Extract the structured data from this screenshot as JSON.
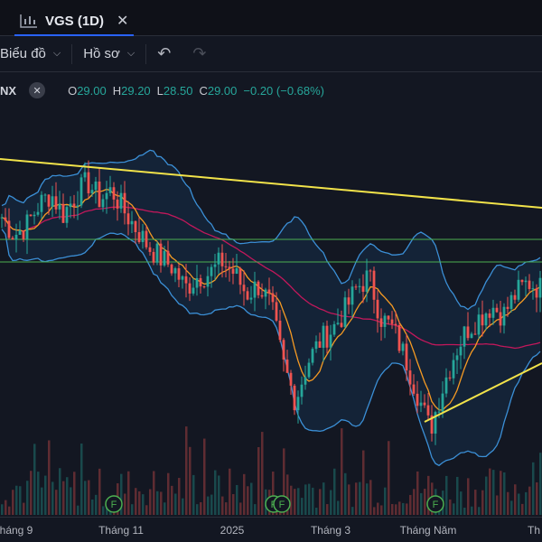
{
  "tab": {
    "title": "VGS (1D)",
    "icon": "chart-icon",
    "close": "✕"
  },
  "toolbar": {
    "chart_label": "Biểu đồ",
    "profile_label": "Hồ sơ",
    "undo_icon": "undo-icon",
    "redo_icon": "redo-icon"
  },
  "legend": {
    "symbol": "NX",
    "o_label": "O",
    "o_value": "29.00",
    "h_label": "H",
    "h_value": "29.20",
    "l_label": "L",
    "l_value": "28.50",
    "c_label": "C",
    "c_value": "29.00",
    "change": "−0.20 (−0.68%)"
  },
  "colors": {
    "up": "#26a69a",
    "down": "#ef5350",
    "trendline": "#f2e34a",
    "bollinger": "#3b8fd6",
    "ma_orange": "#f59a23",
    "ma_red": "#c2185b",
    "hline": "#4caf50",
    "background": "#131722"
  },
  "xaxis": {
    "labels": [
      "háng 9",
      "Tháng 11",
      "2025",
      "Tháng 3",
      "Tháng Năm",
      "Th"
    ]
  },
  "markers": {
    "label": "F"
  },
  "chart_data": {
    "type": "candlestick",
    "description_series": "Daily price with Bollinger bands, moving averages, two trendlines and two horizontal levels",
    "close_path": [
      30.8,
      30.2,
      30.5,
      31.2,
      31.6,
      30.9,
      31.5,
      32.0,
      31.4,
      31.7,
      31.0,
      30.4,
      29.8,
      29.4,
      29.1,
      28.4,
      28.8,
      28.9,
      29.3,
      28.9,
      28.2,
      28.5,
      27.8,
      25.8,
      24.6,
      25.9,
      26.6,
      27.0,
      27.6,
      28.4,
      28.8,
      27.4,
      27.0,
      26.0,
      24.8,
      23.6,
      25.0,
      26.2,
      27.0,
      27.4,
      27.8,
      27.5,
      28.2,
      28.6,
      28.4
    ]
  }
}
